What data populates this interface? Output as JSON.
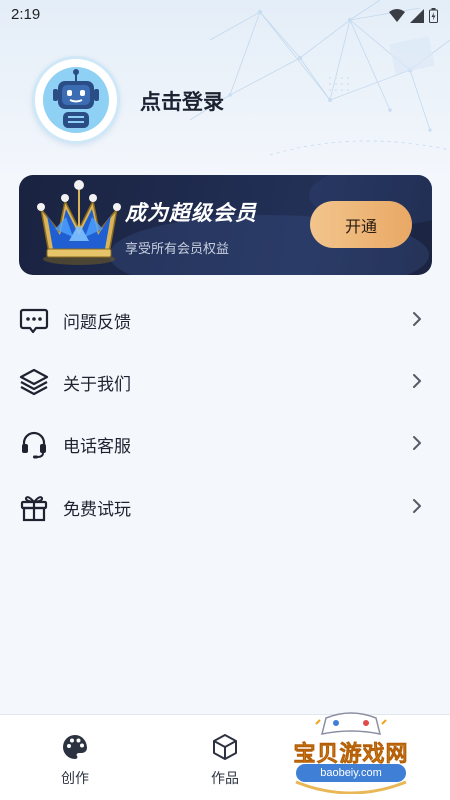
{
  "status_bar": {
    "time": "2:19",
    "icons": [
      "wifi-icon",
      "signal-icon",
      "battery-icon"
    ]
  },
  "profile": {
    "avatar_icon": "robot-icon",
    "login_label": "点击登录"
  },
  "vip": {
    "title": "成为超级会员",
    "subtitle": "享受所有会员权益",
    "button_label": "开通",
    "icon": "crown-icon",
    "colors": {
      "card": "#1f2b4f",
      "button_start": "#f2c58d",
      "button_end": "#e9a865"
    }
  },
  "menu": {
    "items": [
      {
        "label": "问题反馈",
        "icon": "feedback-icon"
      },
      {
        "label": "关于我们",
        "icon": "layers-icon"
      },
      {
        "label": "电话客服",
        "icon": "headset-icon"
      },
      {
        "label": "免费试玩",
        "icon": "gift-icon"
      }
    ]
  },
  "bottom_nav": {
    "items": [
      {
        "label": "创作",
        "icon": "palette-icon"
      },
      {
        "label": "作品",
        "icon": "cube-icon"
      }
    ]
  },
  "watermark": {
    "text": "宝贝游戏网",
    "url": "baobeiy.com"
  }
}
